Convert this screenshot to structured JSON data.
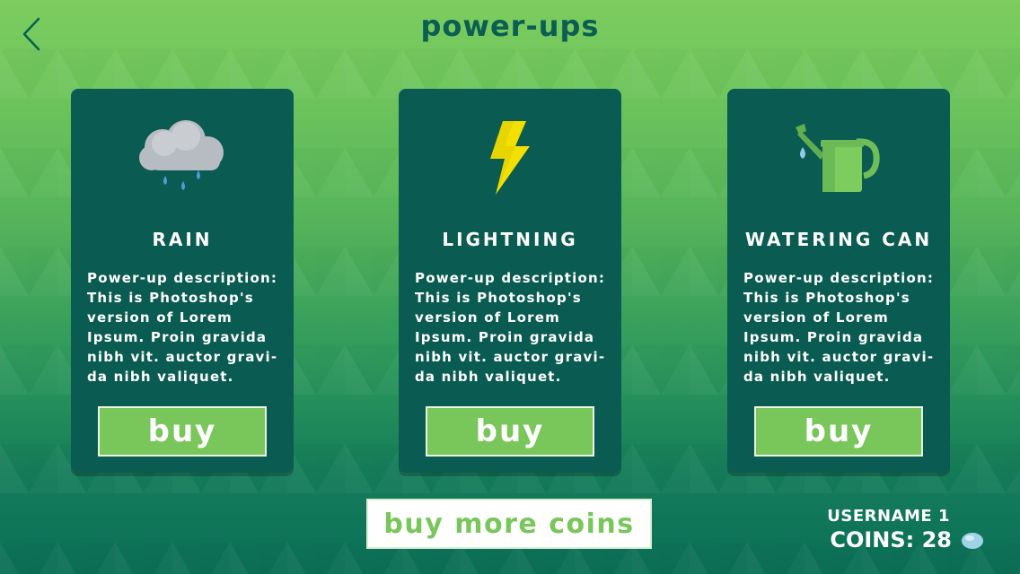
{
  "header": {
    "title": "power-ups",
    "back_icon": "chevron-left-icon"
  },
  "powerups": [
    {
      "name": "RAIN",
      "icon": "rain-cloud-icon",
      "description": "Power-up description:\nThis is Photoshop's\nversion of Lorem\nIpsum. Proin gravida\nnibh vit. auctor gravi-\nda nibh valiquet.",
      "buy_label": "buy"
    },
    {
      "name": "LIGHTNING",
      "icon": "lightning-bolt-icon",
      "description": "Power-up description:\nThis is Photoshop's\nversion of Lorem\nIpsum. Proin gravida\nnibh vit. auctor gravi-\nda nibh valiquet.",
      "buy_label": "buy"
    },
    {
      "name": "WATERING CAN",
      "icon": "watering-can-icon",
      "description": "Power-up description:\nThis is Photoshop's\nversion of Lorem\nIpsum. Proin gravida\nnibh vit. auctor gravi-\nda nibh valiquet.",
      "buy_label": "buy"
    }
  ],
  "footer": {
    "buy_more_coins_label": "buy more coins",
    "username": "USERNAME 1",
    "coins_label": "COINS: 28",
    "coin_icon": "water-drop-coin-icon"
  },
  "colors": {
    "card_bg": "#0a5b51",
    "accent_green": "#79c65a",
    "title_color": "#0b5e52",
    "coin_blue": "#9fd3e6"
  }
}
